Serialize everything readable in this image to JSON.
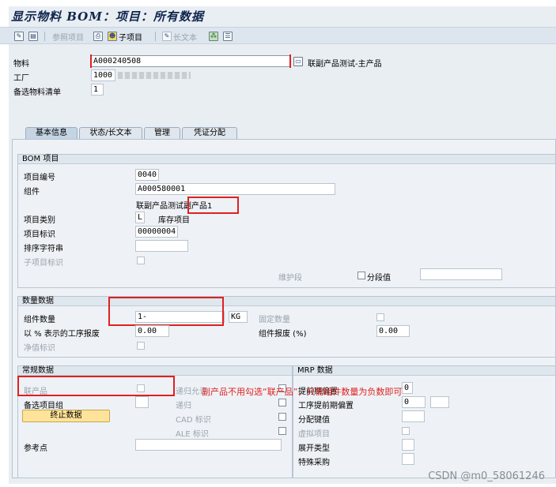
{
  "window": {
    "title": "显示物料 BOM：项目：所有数据"
  },
  "toolbar": {
    "ref_item": "参照项目",
    "sub_item": "子项目",
    "long_text": "长文本"
  },
  "header": {
    "material_label": "物料",
    "material_value": "A000240508",
    "material_desc": "联副产品测试-主产品",
    "plant_label": "工厂",
    "plant_value": "1000",
    "alt_bom_label": "备选物料清单",
    "alt_bom_value": "1"
  },
  "tabs": [
    {
      "label": "基本信息",
      "active": true
    },
    {
      "label": "状态/长文本",
      "active": false
    },
    {
      "label": "管理",
      "active": false
    },
    {
      "label": "凭证分配",
      "active": false
    }
  ],
  "bom_item": {
    "title": "BOM 项目",
    "item_no_label": "项目编号",
    "item_no": "0040",
    "component_label": "组件",
    "component": "A000580001",
    "component_desc_a": "联副产品测试",
    "component_desc_b": "副产品1",
    "item_cat_label": "项目类别",
    "item_cat": "L",
    "item_cat_desc": "库存项目",
    "item_id_label": "项目标识",
    "item_id": "00000004",
    "sort_label": "排序字符串",
    "sub_item_label": "子项目标识",
    "maint_label": "维护段",
    "segment_label": "分段值"
  },
  "qty_data": {
    "title": "数量数据",
    "comp_qty_label": "组件数量",
    "comp_qty": "1-",
    "unit": "KG",
    "fixed_qty_label": "固定数量",
    "op_scrap_label": "以 % 表示的工序报废",
    "op_scrap": "0.00",
    "comp_scrap_label": "组件报废 (%)",
    "comp_scrap": "0.00",
    "net_label": "净值标识"
  },
  "general": {
    "title": "常规数据",
    "co_product_label": "联产品",
    "alt_group_label": "备选项目组",
    "discontinue_button": "终止数据",
    "ref_point_label": "参考点",
    "recursive_allowed_label": "递归允许",
    "recursive_label": "递归",
    "cad_label": "CAD 标识",
    "ale_label": "ALE 标识"
  },
  "mrp": {
    "title": "MRP 数据",
    "lead_offset_label": "提前期偏置",
    "lead_offset": "0",
    "op_lead_offset_label": "工序提前期偏置",
    "op_lead_offset": "0",
    "dist_key_label": "分配键值",
    "phantom_label": "虚拟项目",
    "explosion_label": "展开类型",
    "special_proc_label": "特殊采购"
  },
  "annotation": "副产品不用勾选“联产品”，只需组件数量为负数即可",
  "watermark": "CSDN @m0_58061246",
  "colors": {
    "annotation": "#e02020",
    "title": "#10254d",
    "button": "#ffe39a"
  }
}
